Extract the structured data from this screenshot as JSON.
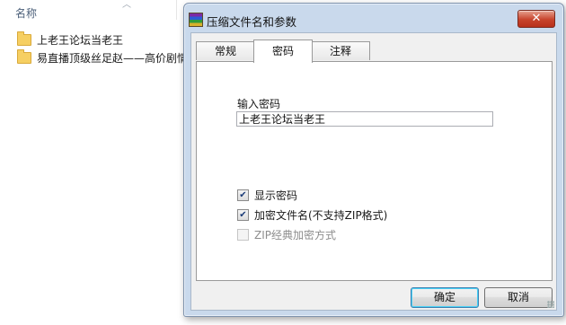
{
  "explorer": {
    "column_header": "名称",
    "files": [
      {
        "name": "上老王论坛当老王",
        "icon": "folder-icon"
      },
      {
        "name": "易直播顶级丝足赵——高价剧情",
        "icon": "folder-icon"
      }
    ]
  },
  "dialog": {
    "title": "压缩文件名和参数",
    "close_glyph": "✕",
    "tabs": [
      {
        "label": "常规",
        "active": false
      },
      {
        "label": "密码",
        "active": true
      },
      {
        "label": "注释",
        "active": false
      }
    ],
    "password_label": "输入密码",
    "password_value": "上老王论坛当老王",
    "options": [
      {
        "label": "显示密码",
        "checked": true,
        "enabled": true
      },
      {
        "label": "加密文件名(不支持ZIP格式)",
        "checked": true,
        "enabled": true
      },
      {
        "label": "ZIP经典加密方式",
        "checked": false,
        "enabled": false
      }
    ],
    "ok_label": "确定",
    "cancel_label": "取消"
  },
  "colors": {
    "frame": "#c9d9ec",
    "close_button": "#c7432b",
    "folder": "#f6cf62"
  }
}
